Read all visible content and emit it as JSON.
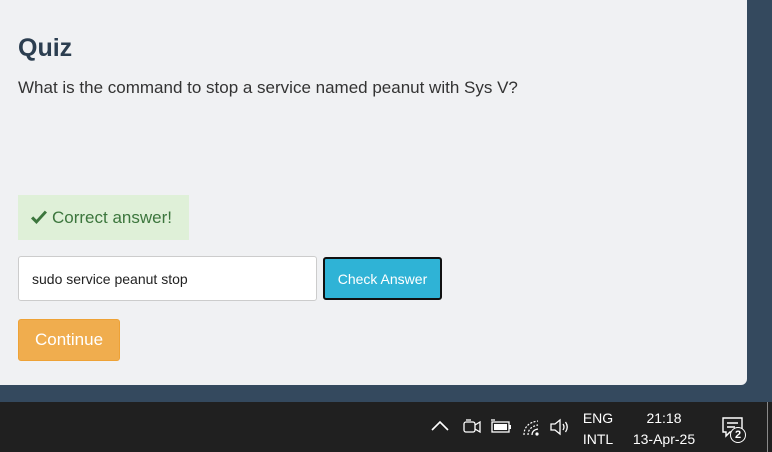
{
  "quiz": {
    "title": "Quiz",
    "question": "What is the command to stop a service named peanut with Sys V?",
    "feedback": "Correct answer!",
    "answer_value": "sudo service peanut stop",
    "check_label": "Check Answer",
    "continue_label": "Continue"
  },
  "taskbar": {
    "lang_line1": "ENG",
    "lang_line2": "INTL",
    "time": "21:18",
    "date": "13-Apr-25",
    "notification_count": "2",
    "tray_icons": [
      "chevron-up-icon",
      "meet-now-icon",
      "battery-icon",
      "wifi-icon",
      "volume-icon"
    ]
  },
  "colors": {
    "backdrop": "#34495e",
    "panel": "#f0f1f3",
    "success_bg": "#dff0d8",
    "success_text": "#3c763d",
    "check_button": "#2fb3d6",
    "continue_button": "#f0ad4e",
    "taskbar": "#202020"
  }
}
